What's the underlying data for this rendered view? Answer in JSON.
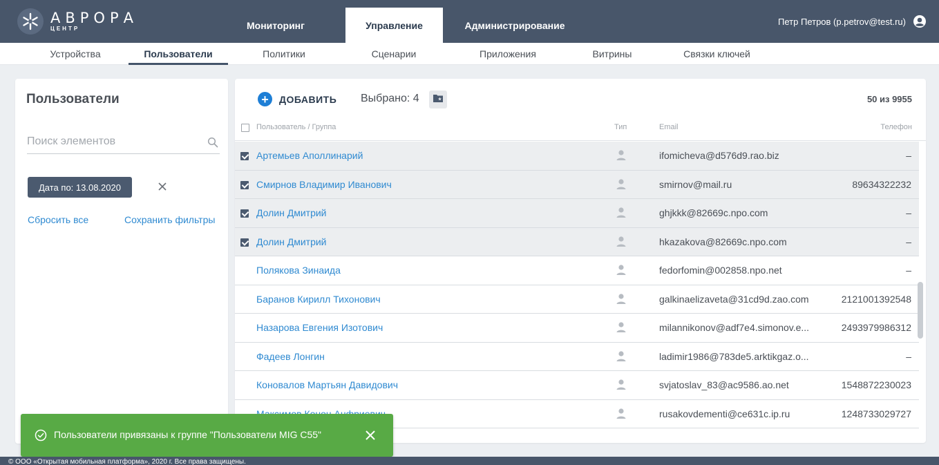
{
  "header": {
    "logo_title": "АВРОРА",
    "logo_subtitle": "ЦЕНТР",
    "tabs": [
      {
        "label": "Мониторинг"
      },
      {
        "label": "Управление"
      },
      {
        "label": "Администрирование"
      }
    ],
    "active_tab": "Управление",
    "user": "Петр Петров (p.petrov@test.ru)"
  },
  "subnav": {
    "items": [
      {
        "label": "Устройства"
      },
      {
        "label": "Пользователи"
      },
      {
        "label": "Политики"
      },
      {
        "label": "Сценарии"
      },
      {
        "label": "Приложения"
      },
      {
        "label": "Витрины"
      },
      {
        "label": "Связки ключей"
      }
    ],
    "active": "Пользователи"
  },
  "sidebar": {
    "title": "Пользователи",
    "search_placeholder": "Поиск элементов",
    "filter_chip": "Дата по: 13.08.2020",
    "reset_label": "Сбросить все",
    "save_label": "Сохранить фильтры"
  },
  "toolbar": {
    "add_label": "ДОБАВИТЬ",
    "selected_label": "Выбрано: 4",
    "count_label": "50 из 9955"
  },
  "table": {
    "columns": {
      "user": "Пользователь / Группа",
      "type": "Тип",
      "email": "Email",
      "phone": "Телефон"
    },
    "rows": [
      {
        "name": "Артемьев Аполлинарий",
        "email": "ifomicheva@d576d9.rao.biz",
        "phone": "–",
        "selected": true
      },
      {
        "name": "Смирнов Владимир Иванович",
        "email": "smirnov@mail.ru",
        "phone": "89634322232",
        "selected": true
      },
      {
        "name": "Долин Дмитрий",
        "email": "ghjkkk@82669c.npo.com",
        "phone": "–",
        "selected": true
      },
      {
        "name": "Долин Дмитрий",
        "email": "hkazakova@82669c.npo.com",
        "phone": "–",
        "selected": true
      },
      {
        "name": "Полякова Зинаида",
        "email": "fedorfomin@002858.npo.net",
        "phone": "–",
        "selected": false
      },
      {
        "name": "Баранов Кирилл Тихонович",
        "email": "galkinaelizaveta@31cd9d.zao.com",
        "phone": "2121001392548",
        "selected": false
      },
      {
        "name": "Назарова Евгения Изотович",
        "email": "milannikonov@adf7e4.simonov.e...",
        "phone": "2493979986312",
        "selected": false
      },
      {
        "name": "Фадеев Лонгин",
        "email": "ladimir1986@783de5.arktikgaz.o...",
        "phone": "–",
        "selected": false
      },
      {
        "name": "Коновалов Мартьян Давидович",
        "email": "svjatoslav_83@ac9586.ao.net",
        "phone": "1548872230023",
        "selected": false
      },
      {
        "name": "Максимов Конон Анфриевич",
        "email": "rusakovdementi@ce631c.ip.ru",
        "phone": "1248733029727",
        "selected": false
      }
    ]
  },
  "toast": {
    "message": "Пользователи привязаны к группе \"Пользователи MIG C55\""
  },
  "footer": {
    "text": "© ООО «Открытая мобильная платформа», 2020 г. Все права защищены."
  },
  "colors": {
    "header_bg": "#48566a",
    "accent_blue": "#2f8ad1",
    "toast_green": "#58aa45",
    "chip_bg": "#4b5a6f"
  }
}
